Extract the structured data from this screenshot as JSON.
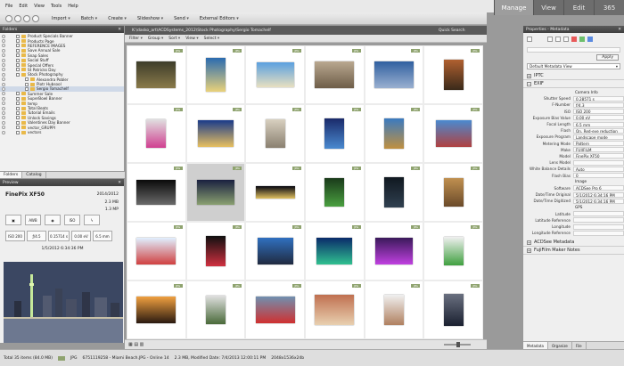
{
  "menu": [
    "File",
    "Edit",
    "View",
    "Tools",
    "Help"
  ],
  "modes": [
    {
      "label": "Manage",
      "active": true
    },
    {
      "label": "View",
      "active": false
    },
    {
      "label": "Edit",
      "active": false
    },
    {
      "label": "365",
      "active": false
    }
  ],
  "toolbar": [
    "Import",
    "Batch",
    "Create",
    "Slideshow",
    "Send",
    "External Editors"
  ],
  "folders": {
    "title": "Folders",
    "items": [
      "Product Specials Banner",
      "Products Page",
      "REFERENCE IMAGES",
      "Save Annual Sale",
      "Snap Sales",
      "Social Stuff",
      "Special Offers",
      "St Patricks Day",
      "Stock Photography",
      "Alexandra Pobler",
      "Piotr Hubsool",
      "Sergio Tomachelf",
      "Summer Sale",
      "SuperBowl Banner",
      "temp",
      "Total Beats",
      "Tutorial Emails",
      "Unlock Savings",
      "Valentines Day Banner",
      "vector_GRUPPI",
      "vectors"
    ],
    "selected": "Sergio Tomachelf",
    "tabs": [
      "Folders",
      "Catalog"
    ]
  },
  "preview": {
    "title": "Preview",
    "camera": "FinePix XF50",
    "date": "2014/2012",
    "size": "2.3 MB",
    "dimensions": "1.3 MP",
    "exif_top": [
      "AWB",
      "ISO"
    ],
    "exif_bottom": [
      "ISO 200",
      "ƒ/4.5",
      "0.15714 s",
      "0.00 eV",
      "6.5 mm"
    ],
    "caption": "1/5/2012 6:34:36 PM"
  },
  "filelist": {
    "path": "K:\\dasko_art\\ACDSystems_2012\\Stock Photography\\Sergio Tomachelf",
    "quick_search": "Quick Search",
    "filters": [
      "Filter",
      "Group",
      "Sort",
      "View",
      "Select"
    ],
    "badge": "JPG"
  },
  "properties": {
    "title": "Properties - Metadata",
    "apply": "Apply",
    "view": "Default Metadata View",
    "sections": [
      "IPTC",
      "EXIF",
      "ACDSee Metadata",
      "FujiFilm Maker Notes"
    ],
    "exif": [
      [
        "",
        "Camera Info"
      ],
      [
        "Shutter Speed",
        "0.28571 s"
      ],
      [
        "F-Number",
        "f/4.3"
      ],
      [
        "ISO",
        "ISO 200"
      ],
      [
        "Exposure Bias Value",
        "0.00 eV"
      ],
      [
        "Focal Length",
        "6.5 mm"
      ],
      [
        "Flash",
        "On, Red-eye reduction"
      ],
      [
        "Exposure Program",
        "Landscape mode"
      ],
      [
        "Metering Mode",
        "Pattern"
      ],
      [
        "Make",
        "FUJIFILM"
      ],
      [
        "Model",
        "FinePix XF50"
      ],
      [
        "Lens Model",
        ""
      ],
      [
        "White Balance Details",
        "Auto"
      ],
      [
        "Flash Bias",
        "0"
      ],
      [
        "",
        "Image"
      ],
      [
        "Software",
        "ACDSee Pro 6"
      ],
      [
        "Date/Time Original",
        "5/1/2012 6:34:16 PM"
      ],
      [
        "Date/Time Digitized",
        "5/1/2012 6:34:16 PM"
      ],
      [
        "",
        "GPS"
      ],
      [
        "Latitude",
        ""
      ],
      [
        "Latitude Reference",
        ""
      ],
      [
        "Longitude",
        ""
      ],
      [
        "Longitude Reference",
        ""
      ]
    ],
    "tabs": [
      "Metadata",
      "Organize",
      "File"
    ]
  },
  "status": {
    "total": "Total 35 items (84.0 MB)",
    "type": "JPG",
    "file": "6751119258 - Miami Beach.JPG - Online 14",
    "info": "2.3 MB, Modified Date: 7/4/2013 12:00:11 PM",
    "dims": "2048x1536x24b"
  },
  "colors": {
    "accent": "#8fa36f",
    "panel_header": "#4a4a4a",
    "selection": "#cfd9e8"
  }
}
